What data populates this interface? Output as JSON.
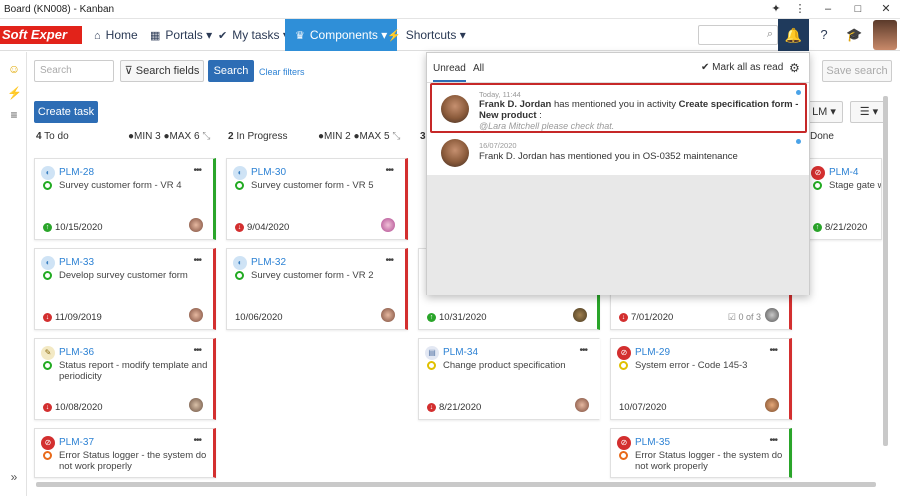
{
  "window": {
    "title": "Board (KN008) - Kanban"
  },
  "logo": {
    "text": "Soft Exper"
  },
  "nav": {
    "home": "Home",
    "portals": "Portals",
    "my_tasks": "My tasks",
    "components": "Components",
    "shortcuts": "Shortcuts"
  },
  "toolbar": {
    "search_placeholder": "Search",
    "search_fields": "Search fields",
    "search_button": "Search",
    "clear_filters": "Clear filters",
    "save_search": "Save search",
    "create_task": "Create task",
    "plm_filter": "LM"
  },
  "columns": [
    {
      "count": "4",
      "name": "To do",
      "min": "MIN 3",
      "max": "MAX 6"
    },
    {
      "count": "2",
      "name": "In Progress",
      "min": "MIN 2",
      "max": "MAX 5"
    },
    {
      "count": "3",
      "name": ""
    },
    {
      "count": "",
      "name": ""
    },
    {
      "count": "",
      "name": "Done"
    }
  ],
  "cards": [
    {
      "id": "PLM-28",
      "title": "Survey customer form - VR 4",
      "date": "10/15/2020"
    },
    {
      "id": "PLM-33",
      "title": "Develop survey customer form",
      "date": "11/09/2019"
    },
    {
      "id": "PLM-36",
      "title": "Status report - modify template and periodicity",
      "date": "10/08/2020"
    },
    {
      "id": "PLM-37",
      "title": "Error Status logger - the system do not work properly",
      "date": ""
    },
    {
      "id": "PLM-30",
      "title": "Survey customer form - VR 5",
      "date": "9/04/2020"
    },
    {
      "id": "PLM-32",
      "title": "Survey customer form - VR 2",
      "date": "10/06/2020"
    },
    {
      "id": "",
      "title": "",
      "date": "10/31/2020"
    },
    {
      "id": "PLM-34",
      "title": "Change product specification",
      "date": "8/21/2020"
    },
    {
      "id": "",
      "title": "",
      "date": "7/01/2020",
      "check": "0 of 3"
    },
    {
      "id": "PLM-29",
      "title": "System error - Code 145-3",
      "date": "10/07/2020"
    },
    {
      "id": "PLM-35",
      "title": "Error Status logger - the system do not work properly",
      "date": ""
    },
    {
      "id": "PLM-4",
      "title": "Stage gate wor",
      "date": "8/21/2020"
    }
  ],
  "notifications": {
    "tab_unread": "Unread",
    "tab_all": "All",
    "mark_all": "Mark all as read",
    "items": [
      {
        "time": "Today, 11:44",
        "actor": "Frank D. Jordan",
        "text": "has mentioned you in activity",
        "object": "Create specification form - New product",
        "suffix": ":",
        "message": "@Lara Mitchell please check that."
      },
      {
        "time": "16/07/2020",
        "text": "Frank D. Jordan has mentioned you in OS-0352 maintenance"
      }
    ]
  },
  "colors": {
    "accent": "#2f8fd8",
    "navy": "#1f3a5c",
    "green": "#2aa52a",
    "red": "#d32f2f",
    "highlight": "#c62828"
  }
}
